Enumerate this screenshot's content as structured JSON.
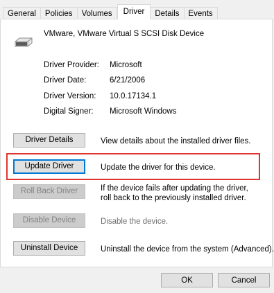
{
  "tabs": [
    {
      "label": "General"
    },
    {
      "label": "Policies"
    },
    {
      "label": "Volumes"
    },
    {
      "label": "Driver"
    },
    {
      "label": "Details"
    },
    {
      "label": "Events"
    }
  ],
  "active_tab": "Driver",
  "device": {
    "icon": "disk-drive-icon",
    "name": "VMware, VMware Virtual S SCSI Disk Device"
  },
  "driver_info": [
    {
      "label": "Driver Provider:",
      "value": "Microsoft"
    },
    {
      "label": "Driver Date:",
      "value": "6/21/2006"
    },
    {
      "label": "Driver Version:",
      "value": "10.0.17134.1"
    },
    {
      "label": "Digital Signer:",
      "value": "Microsoft Windows"
    }
  ],
  "actions": [
    {
      "button": "Driver Details",
      "description": "View details about the installed driver files.",
      "enabled": true
    },
    {
      "button": "Update Driver",
      "description": "Update the driver for this device.",
      "enabled": true
    },
    {
      "button": "Roll Back Driver",
      "description": "If the device fails after updating the driver, roll back to the previously installed driver.",
      "enabled": false
    },
    {
      "button": "Disable Device",
      "description": "Disable the device.",
      "enabled": false
    },
    {
      "button": "Uninstall Device",
      "description": "Uninstall the device from the system (Advanced).",
      "enabled": true
    }
  ],
  "footer": {
    "ok_label": "OK",
    "cancel_label": "Cancel"
  },
  "colors": {
    "highlight": "#e0352e",
    "focus": "#0078d7"
  }
}
